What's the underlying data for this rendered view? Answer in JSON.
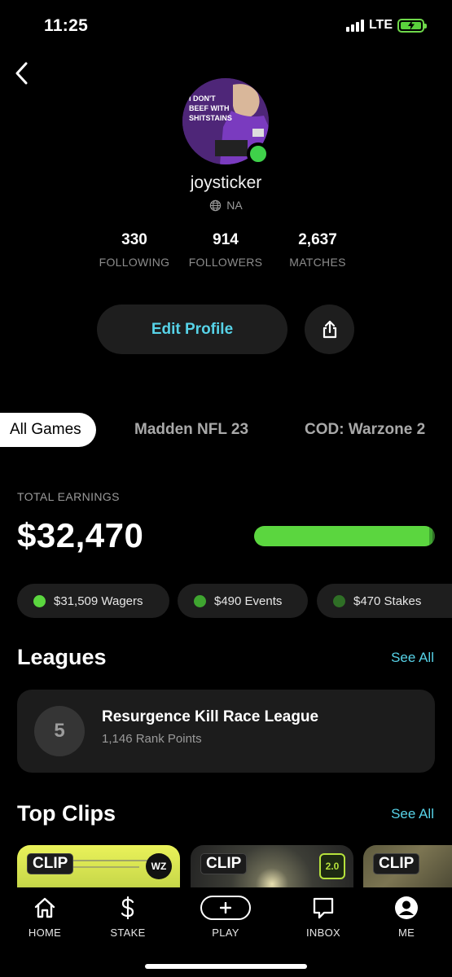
{
  "status": {
    "time": "11:25",
    "network": "LTE"
  },
  "profile": {
    "username": "joysticker",
    "region": "NA",
    "avatar_text": "I DON'T BEEF WITH SHITSTAINS",
    "stats": [
      {
        "value": "330",
        "label": "FOLLOWING"
      },
      {
        "value": "914",
        "label": "FOLLOWERS"
      },
      {
        "value": "2,637",
        "label": "MATCHES"
      }
    ],
    "edit_label": "Edit Profile"
  },
  "tabs": [
    "All Games",
    "Madden NFL 23",
    "COD: Warzone 2"
  ],
  "earnings": {
    "label": "TOTAL EARNINGS",
    "value": "$32,470",
    "breakdown": [
      {
        "text": "$31,509 Wagers",
        "color": "#5bd63f",
        "amount": 31509
      },
      {
        "text": "$490 Events",
        "color": "#3fa530",
        "amount": 490
      },
      {
        "text": "$470 Stakes",
        "color": "#2f6f26",
        "amount": 470
      }
    ]
  },
  "leagues": {
    "title": "Leagues",
    "see_all": "See All",
    "item": {
      "rank": "5",
      "name": "Resurgence Kill Race League",
      "points": "1,146 Rank Points"
    }
  },
  "clips": {
    "title": "Top Clips",
    "see_all": "See All",
    "items": [
      {
        "tag": "CLIP",
        "badge": "WZ"
      },
      {
        "tag": "CLIP",
        "badge": "2.0"
      },
      {
        "tag": "CLIP",
        "badge": ""
      }
    ]
  },
  "nav": [
    {
      "label": "HOME",
      "icon": "home-icon"
    },
    {
      "label": "STAKE",
      "icon": "dollar-icon"
    },
    {
      "label": "PLAY",
      "icon": "plus-icon"
    },
    {
      "label": "INBOX",
      "icon": "chat-icon"
    },
    {
      "label": "ME",
      "icon": "user-icon"
    }
  ],
  "colors": {
    "accent": "#57d3e8",
    "green": "#5bd63f",
    "card": "#1e1e1e"
  }
}
